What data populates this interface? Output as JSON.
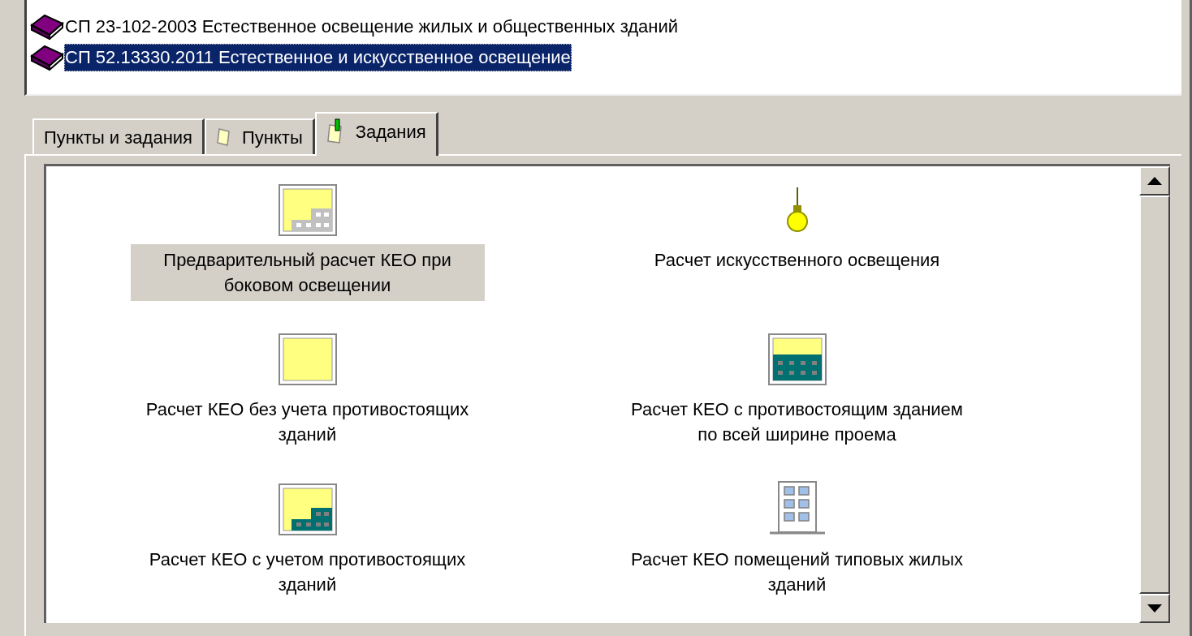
{
  "documents": [
    {
      "label": "СП 23-102-2003 Естественное освещение жилых и общественных зданий",
      "selected": false
    },
    {
      "label": "СП 52.13330.2011 Естественное и искусственное освещение",
      "selected": true
    }
  ],
  "tabs": [
    {
      "label": "Пункты и задания",
      "kind": "plain",
      "selected": false
    },
    {
      "label": "Пункты",
      "kind": "notes",
      "selected": false
    },
    {
      "label": "Задания",
      "kind": "tasks",
      "selected": true
    }
  ],
  "tasks": [
    {
      "kind": "window-grey-steps",
      "label": "Предварительный расчет КЕО при боковом освещении",
      "selected": true
    },
    {
      "kind": "bulb",
      "label": "Расчет искусственного освещения",
      "selected": false
    },
    {
      "kind": "window-plain",
      "label": "Расчет КЕО без учета противостоящих зданий",
      "selected": false
    },
    {
      "kind": "window-teal-full",
      "label": "Расчет КЕО с противостоящим зданием по всей ширине проема",
      "selected": false
    },
    {
      "kind": "window-teal-steps",
      "label": "Расчет КЕО с учетом противостоящих зданий",
      "selected": false
    },
    {
      "kind": "building",
      "label": "Расчет КЕО помещений типовых жилых зданий",
      "selected": false
    }
  ]
}
